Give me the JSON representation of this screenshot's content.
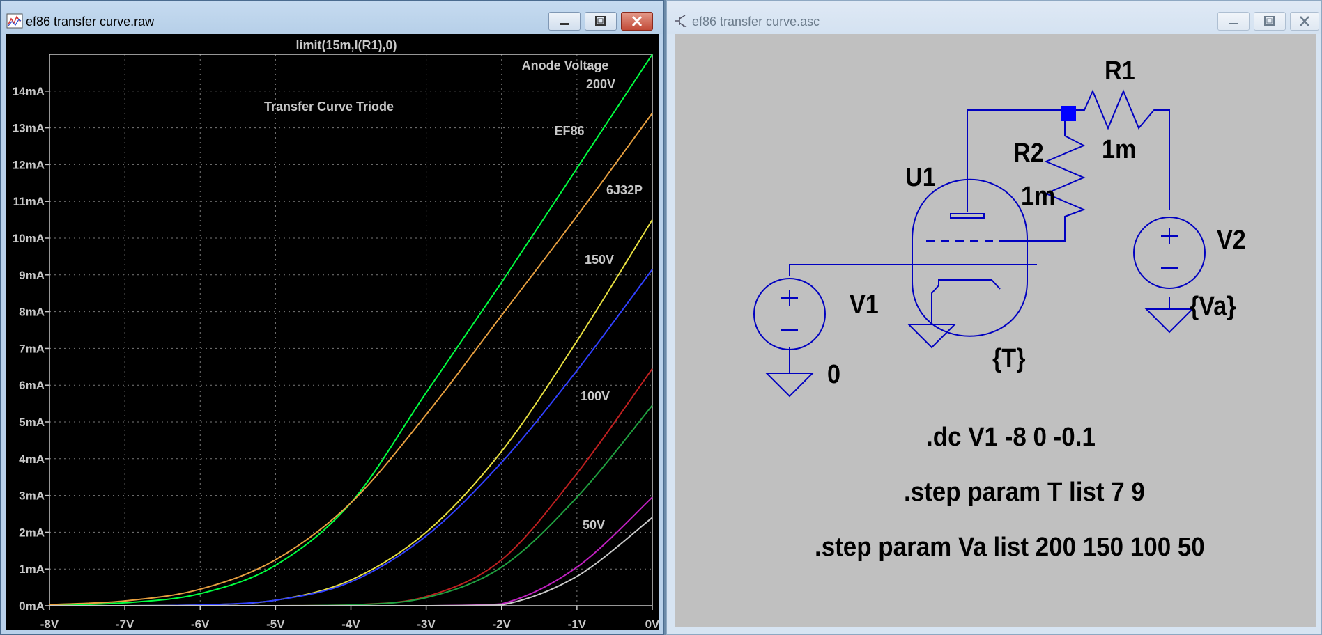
{
  "left_window": {
    "title": "ef86 transfer curve.raw",
    "icon": "waveform-icon",
    "controls": [
      "minimize-icon",
      "maximize-icon",
      "close-icon"
    ]
  },
  "right_window": {
    "title": "ef86 transfer curve.asc",
    "icon": "transistor-icon",
    "controls": [
      "minimize-icon",
      "maximize-icon",
      "close-icon"
    ]
  },
  "plot": {
    "trace_expression": "limit(15m,I(R1),0)",
    "annotations": {
      "anode_voltage": "Anode Voltage",
      "transfer_title": "Transfer Curve Triode",
      "ef86": "EF86",
      "sixj32p": "6J32P",
      "v200": "200V",
      "v150": "150V",
      "v100": "100V",
      "v50": "50V"
    }
  },
  "chart_data": {
    "type": "line",
    "xlabel": "",
    "ylabel": "",
    "xlim": [
      -8,
      0
    ],
    "ylim": [
      0,
      15
    ],
    "x_ticks": [
      "-8V",
      "-7V",
      "-6V",
      "-5V",
      "-4V",
      "-3V",
      "-2V",
      "-1V",
      "0V"
    ],
    "y_ticks": [
      "0mA",
      "1mA",
      "2mA",
      "3mA",
      "4mA",
      "5mA",
      "6mA",
      "7mA",
      "8mA",
      "9mA",
      "10mA",
      "11mA",
      "12mA",
      "13mA",
      "14mA"
    ],
    "grid": true,
    "background": "#000000",
    "x": [
      -8,
      -7,
      -6,
      -5,
      -4,
      -3,
      -2,
      -1,
      0
    ],
    "series": [
      {
        "color": "#00ff40",
        "values": [
          0.02,
          0.08,
          0.33,
          1.1,
          2.8,
          5.8,
          8.8,
          11.9,
          15.0
        ]
      },
      {
        "color": "#e8a040",
        "values": [
          0.03,
          0.13,
          0.45,
          1.25,
          2.8,
          5.2,
          7.9,
          10.6,
          13.4
        ]
      },
      {
        "color": "#e8e040",
        "values": [
          0.0,
          0.0,
          0.02,
          0.15,
          0.7,
          2.0,
          4.2,
          7.2,
          10.5
        ]
      },
      {
        "color": "#3040ff",
        "values": [
          0.0,
          0.0,
          0.02,
          0.15,
          0.65,
          1.9,
          3.9,
          6.4,
          9.15
        ]
      },
      {
        "color": "#c02020",
        "values": [
          0.0,
          0.0,
          0.0,
          0.0,
          0.02,
          0.25,
          1.25,
          3.6,
          6.45
        ]
      },
      {
        "color": "#20a040",
        "values": [
          0.0,
          0.0,
          0.0,
          0.0,
          0.02,
          0.22,
          1.05,
          2.95,
          5.45
        ]
      },
      {
        "color": "#c020c0",
        "values": [
          0.0,
          0.0,
          0.0,
          0.0,
          0.0,
          0.0,
          0.05,
          1.05,
          2.95
        ]
      },
      {
        "color": "#c8c8c8",
        "values": [
          0.0,
          0.0,
          0.0,
          0.0,
          0.0,
          0.0,
          0.02,
          0.8,
          2.4
        ]
      }
    ]
  },
  "schematic": {
    "labels": {
      "r1": "R1",
      "r1_value": "1m",
      "r2": "R2",
      "r2_value": "1m",
      "u1": "U1",
      "u1_value": "{T}",
      "v1": "V1",
      "v1_value": "0",
      "v2": "V2",
      "v2_value": "{Va}"
    },
    "directives": {
      "dc": ".dc V1 -8 0 -0.1",
      "step_t": ".step param T list  7 9",
      "step_va": ".step param Va  list 200 150 100 50"
    },
    "wire_color": "#0000c0",
    "node_color": "#0000ff"
  }
}
